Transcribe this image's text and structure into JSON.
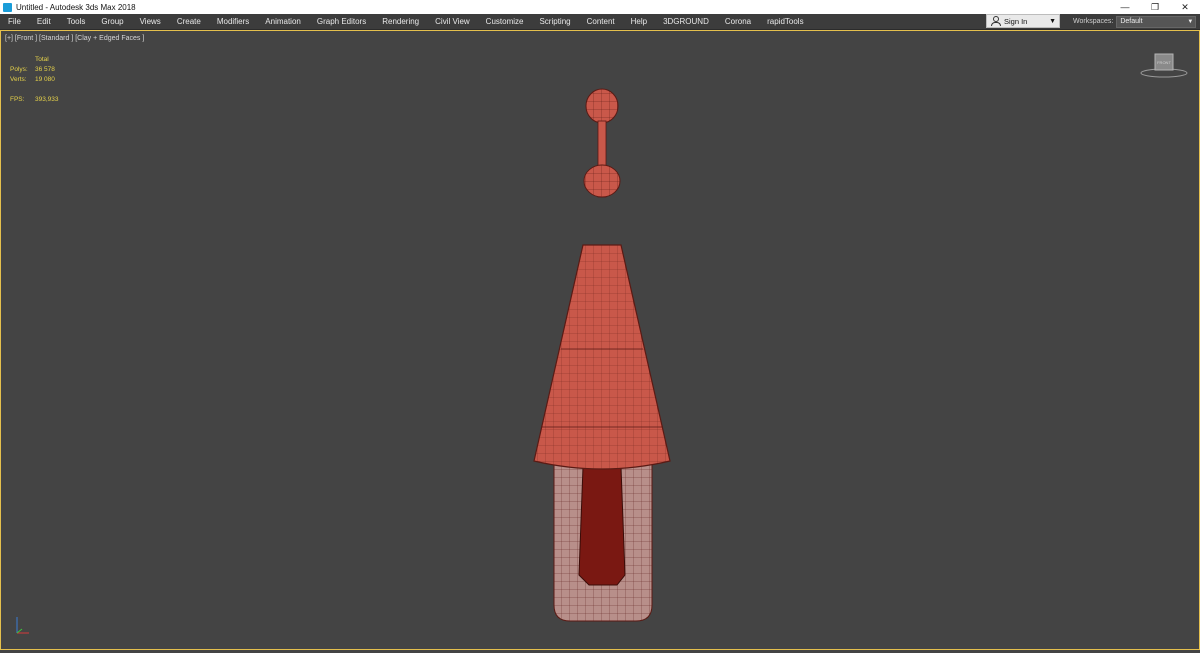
{
  "window": {
    "title": "Untitled - Autodesk 3ds Max 2018",
    "controls": [
      "—",
      "❐",
      "✕"
    ]
  },
  "menubar": {
    "items": [
      "File",
      "Edit",
      "Tools",
      "Group",
      "Views",
      "Create",
      "Modifiers",
      "Animation",
      "Graph Editors",
      "Rendering",
      "Civil View",
      "Customize",
      "Scripting",
      "Content",
      "Help",
      "3DGROUND",
      "Corona",
      "rapidTools"
    ]
  },
  "account": {
    "signin_label": "Sign In"
  },
  "workspaces": {
    "label": "Workspaces:",
    "selected": "Default"
  },
  "viewport": {
    "label": "[+] [Front ] [Standard ] [Clay + Edged Faces ]",
    "stats": {
      "header": "Total",
      "polys_label": "Polys:",
      "polys_value": "36 578",
      "verts_label": "Verts:",
      "verts_value": "19 080",
      "fps_label": "FPS:",
      "fps_value": "393,933"
    },
    "viewcube_face": "FRONT"
  },
  "colors": {
    "viewport_bg": "#444444",
    "active_border": "#e5c04d",
    "stats_text": "#e6d24a",
    "model_fill": "#c9584a",
    "model_wire": "#5a1a14"
  },
  "icons": [
    "app-icon",
    "user-icon",
    "chevron-down-icon",
    "viewcube-icon",
    "axis-tripod-icon"
  ]
}
